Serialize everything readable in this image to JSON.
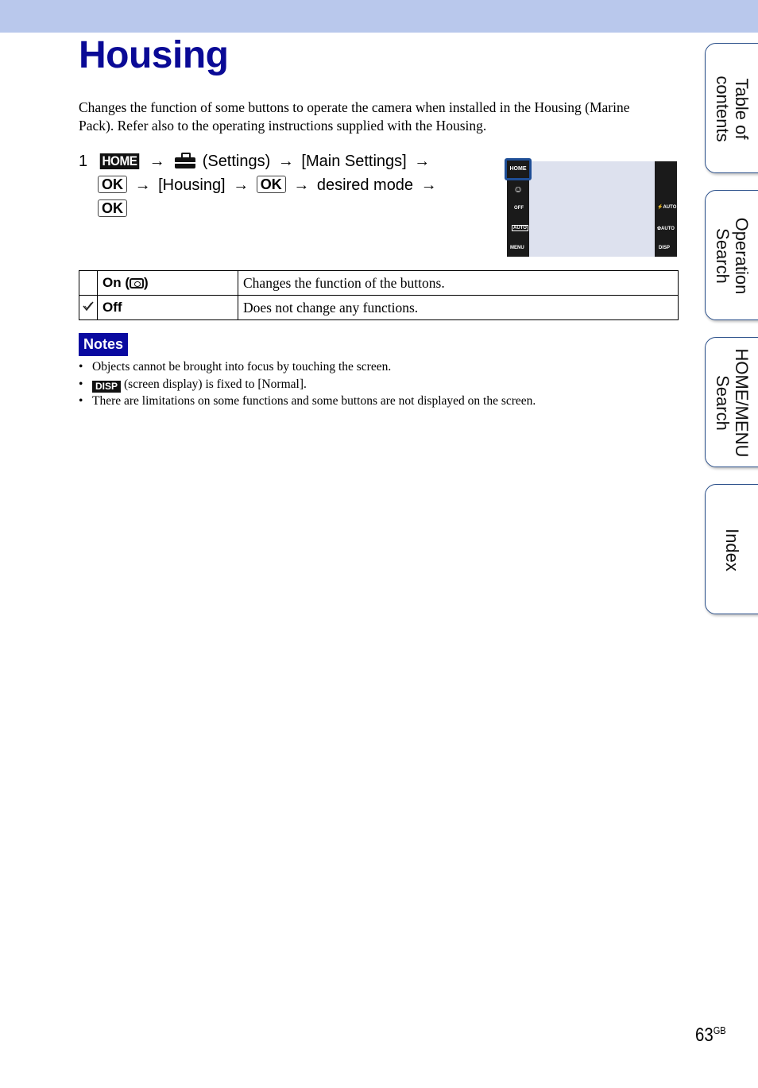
{
  "page": {
    "title": "Housing",
    "intro": "Changes the function of some buttons to operate the camera when installed in the Housing (Marine Pack). Refer also to the operating instructions supplied with the Housing.",
    "page_number": "63",
    "page_suffix": "GB"
  },
  "step": {
    "number": "1",
    "home_label": "HOME",
    "arrow": "→",
    "settings_icon": "toolbox-icon",
    "settings_text": "(Settings)",
    "main_settings_text": "[Main Settings]",
    "ok_label": "OK",
    "housing_text": "[Housing]",
    "desired_mode_text": "desired mode"
  },
  "screen": {
    "home": "HOME",
    "left_icons": [
      "smile-shutter-icon",
      "self-timer-off-icon",
      "iso-auto-icon"
    ],
    "menu": "MENU",
    "right_icons": [
      "flash-auto-icon",
      "macro-auto-icon"
    ],
    "disp": "DISP",
    "accent_color": "#1f4e96"
  },
  "options": [
    {
      "checked": false,
      "label": "On (",
      "icon": "housing-icon",
      "label_end": ")",
      "description": "Changes the function of the buttons."
    },
    {
      "checked": true,
      "label": "Off",
      "description": "Does not change any functions."
    }
  ],
  "notes": {
    "label": "Notes",
    "items": [
      {
        "text": "Objects cannot be brought into focus by touching the screen."
      },
      {
        "badge": "DISP",
        "text": "(screen display) is fixed to [Normal]."
      },
      {
        "text": "There are limitations on some functions and some buttons are not displayed on the screen."
      }
    ]
  },
  "side_tabs": [
    {
      "label": "Table of contents",
      "line1": "Table of",
      "line2": "contents"
    },
    {
      "label": "Operation Search",
      "line1": "Operation",
      "line2": "Search"
    },
    {
      "label": "HOME/MENU Search",
      "line1": "HOME/MENU",
      "line2": "Search"
    },
    {
      "label": "Index",
      "line1": "Index",
      "line2": ""
    }
  ],
  "colors": {
    "header_band": "#b9c8ec",
    "title": "#0a0a96",
    "notes_bg": "#0a0aa0",
    "tab_border": "#2a4f8a"
  }
}
